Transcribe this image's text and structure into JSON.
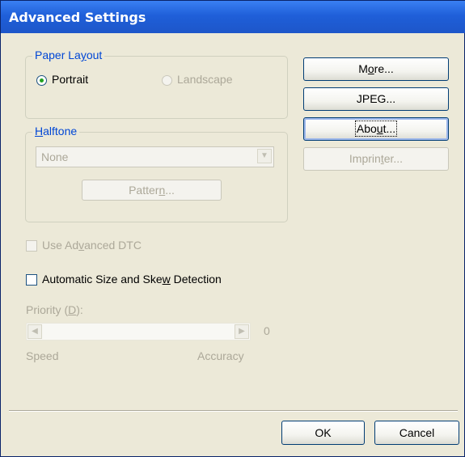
{
  "window": {
    "title": "Advanced Settings"
  },
  "paper_layout": {
    "legend_pre": "Paper La",
    "legend_u": "y",
    "legend_post": "out",
    "portrait": "Portrait",
    "portrait_checked": true,
    "landscape": "Landscape",
    "landscape_checked": false
  },
  "halftone": {
    "legend_u": "H",
    "legend_post": "alftone",
    "select_value": "None",
    "pattern_pre": "Patter",
    "pattern_u": "n",
    "pattern_post": "..."
  },
  "right_buttons": {
    "more_pre": "M",
    "more_u": "o",
    "more_post": "re...",
    "jpeg": "JPEG...",
    "about_pre": "Abo",
    "about_u": "u",
    "about_post": "t...",
    "imprinter_pre": "Imprin",
    "imprinter_u": "t",
    "imprinter_post": "er..."
  },
  "advanced_dtc": {
    "pre": "Use Ad",
    "u": "v",
    "post": "anced DTC",
    "checked": false
  },
  "auto_detect": {
    "pre": "Automatic Size and Ske",
    "u": "w",
    "post": " Detection",
    "checked": false
  },
  "priority": {
    "label_pre": "Priority (",
    "label_u": "D",
    "label_post": "):",
    "value": "0",
    "left_label": "Speed",
    "right_label": "Accuracy"
  },
  "footer": {
    "ok": "OK",
    "cancel": "Cancel"
  },
  "colors": {
    "titlebar": "#1f5fd9",
    "legend": "#0046d5",
    "disabled": "#aca899",
    "window_bg": "#ece9d8"
  }
}
